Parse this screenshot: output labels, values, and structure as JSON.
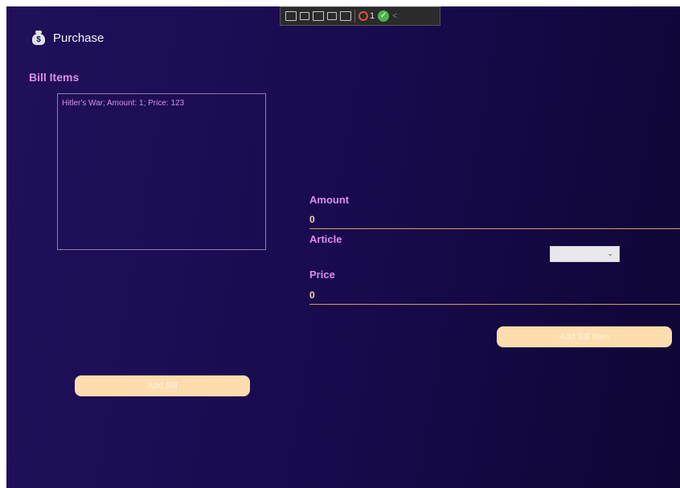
{
  "window": {
    "title": "Purchase"
  },
  "sections": {
    "bill_items_label": "Bill Items"
  },
  "bill_items": [
    "Hitler's War; Amount: 1; Price: 123"
  ],
  "form": {
    "amount_label": "Amount",
    "amount_value": "0",
    "article_label": "Article",
    "article_selected": "",
    "price_label": "Price",
    "price_value": "0"
  },
  "buttons": {
    "add_bill_item": "Add Bill Item",
    "add_bill": "Add Bill"
  },
  "debug_toolbar": {
    "error_count": "1"
  },
  "colors": {
    "accent_purple": "#d98ee8",
    "value_peach": "#f7d9a6",
    "button_bg": "#fddcad",
    "background": "#1a0b50"
  }
}
